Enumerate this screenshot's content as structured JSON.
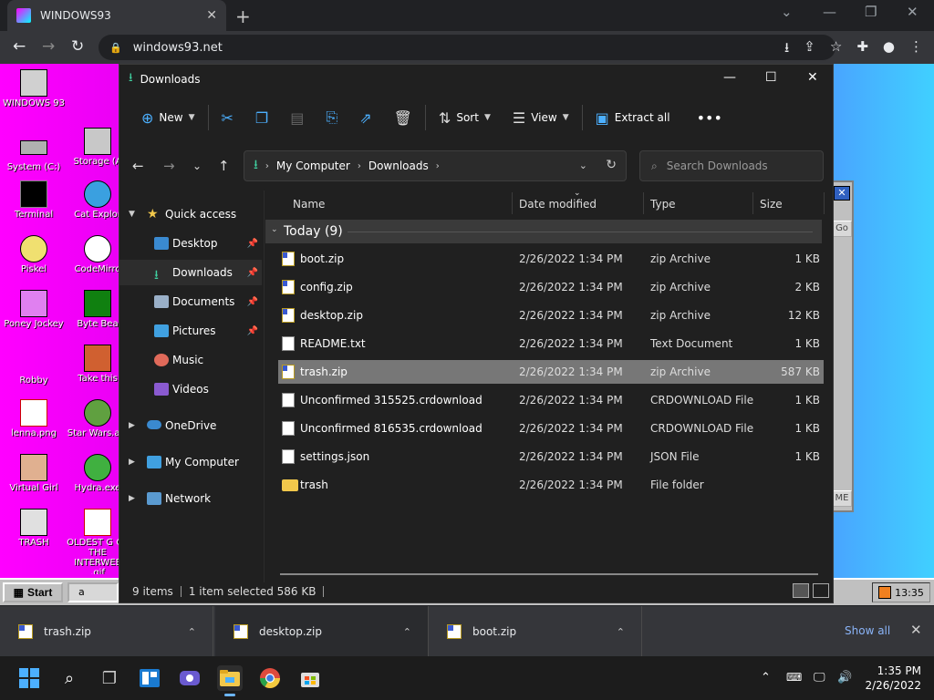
{
  "browser": {
    "tab_title": "WINDOWS93",
    "url": "windows93.net"
  },
  "desktop": {
    "icons": [
      {
        "label": "WINDOWS 93",
        "color": "#d0d0d0"
      },
      {
        "label": "System (C:)",
        "color": "#b0b0b0"
      },
      {
        "label": "Storage (A",
        "color": "#c8c8c8"
      },
      {
        "label": "Terminal",
        "color": "#000000"
      },
      {
        "label": "Cat Explor",
        "color": "#3aa0e0"
      },
      {
        "label": "Piskel",
        "color": "#f0e070"
      },
      {
        "label": "CodeMirro",
        "color": "#ffffff"
      },
      {
        "label": "Poney Jockey",
        "color": "#e080f0"
      },
      {
        "label": "Byte Bea",
        "color": "#20a020"
      },
      {
        "label": "Robby",
        "color": "#e000e0"
      },
      {
        "label": "Take this",
        "color": "#d06030"
      },
      {
        "label": "lenna.png",
        "color": "#ffffff"
      },
      {
        "label": "Star Wars.avi",
        "color": "#60a040"
      },
      {
        "label": "Virtual Girl",
        "color": "#e0b090"
      },
      {
        "label": "Hydra.exe",
        "color": "#40b040"
      },
      {
        "label": "TRASH",
        "color": "#e0e0e0"
      },
      {
        "label": "OLDEST G OF THE INTERWEE .gif",
        "color": "#ffffff"
      }
    ],
    "start_label": "Start",
    "task_label": "a",
    "clock": "13:35",
    "bgwin_go": "Go",
    "bgwin_me": "ME"
  },
  "explorer": {
    "title": "Downloads",
    "toolbar": {
      "new": "New",
      "sort": "Sort",
      "view": "View",
      "extract": "Extract all"
    },
    "path": [
      "My Computer",
      "Downloads"
    ],
    "search_placeholder": "Search Downloads",
    "sidebar": {
      "quick_access": "Quick access",
      "items": [
        "Desktop",
        "Downloads",
        "Documents",
        "Pictures",
        "Music",
        "Videos"
      ],
      "onedrive": "OneDrive",
      "mycomputer": "My Computer",
      "network": "Network"
    },
    "columns": {
      "name": "Name",
      "date": "Date modified",
      "type": "Type",
      "size": "Size"
    },
    "group": "Today (9)",
    "files": [
      {
        "name": "boot.zip",
        "date": "2/26/2022 1:34 PM",
        "type": "zip Archive",
        "size": "1 KB",
        "kind": "zip"
      },
      {
        "name": "config.zip",
        "date": "2/26/2022 1:34 PM",
        "type": "zip Archive",
        "size": "2 KB",
        "kind": "zip"
      },
      {
        "name": "desktop.zip",
        "date": "2/26/2022 1:34 PM",
        "type": "zip Archive",
        "size": "12 KB",
        "kind": "zip"
      },
      {
        "name": "README.txt",
        "date": "2/26/2022 1:34 PM",
        "type": "Text Document",
        "size": "1 KB",
        "kind": "doc"
      },
      {
        "name": "trash.zip",
        "date": "2/26/2022 1:34 PM",
        "type": "zip Archive",
        "size": "587 KB",
        "kind": "zip"
      },
      {
        "name": "Unconfirmed 315525.crdownload",
        "date": "2/26/2022 1:34 PM",
        "type": "CRDOWNLOAD File",
        "size": "1 KB",
        "kind": "doc"
      },
      {
        "name": "Unconfirmed 816535.crdownload",
        "date": "2/26/2022 1:34 PM",
        "type": "CRDOWNLOAD File",
        "size": "1 KB",
        "kind": "doc"
      },
      {
        "name": "settings.json",
        "date": "2/26/2022 1:34 PM",
        "type": "JSON File",
        "size": "1 KB",
        "kind": "doc"
      },
      {
        "name": "trash",
        "date": "2/26/2022 1:34 PM",
        "type": "File folder",
        "size": "",
        "kind": "folder"
      }
    ],
    "status": {
      "count": "9 items",
      "selected": "1 item selected  586 KB"
    }
  },
  "shelf": {
    "items": [
      "trash.zip",
      "desktop.zip",
      "boot.zip"
    ],
    "show_all": "Show all"
  },
  "taskbar": {
    "time": "1:35 PM",
    "date": "2/26/2022"
  }
}
